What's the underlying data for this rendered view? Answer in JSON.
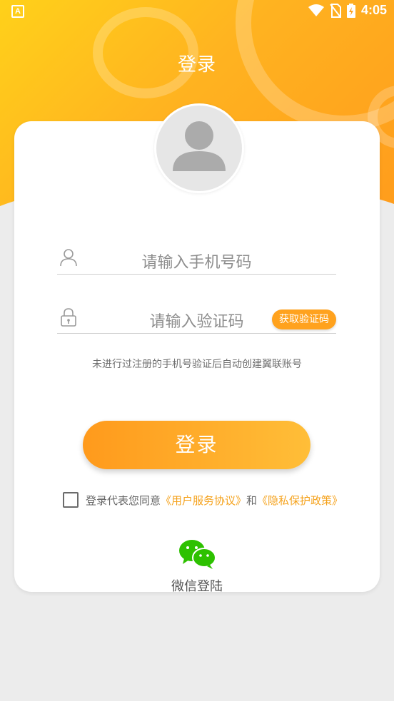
{
  "status_bar": {
    "app_badge": "A",
    "time": "4:05"
  },
  "header": {
    "title": "登录"
  },
  "form": {
    "phone_placeholder": "请输入手机号码",
    "code_placeholder": "请输入验证码",
    "get_code_label": "获取验证码",
    "hint": "未进行过注册的手机号验证后自动创建翼联账号",
    "login_label": "登录"
  },
  "agreement": {
    "prefix": "登录代表您同意",
    "user_agreement": "《用户服务协议》",
    "and": "和",
    "privacy_policy": "《隐私保护政策》",
    "checked": false
  },
  "wechat": {
    "label": "微信登陆"
  },
  "colors": {
    "accent": "#ffa21e",
    "wechat_green": "#2dc100"
  },
  "icons": [
    "app-icon",
    "wifi-icon",
    "no-sim-icon",
    "battery-icon",
    "avatar-icon",
    "user-icon",
    "lock-icon",
    "wechat-icon"
  ]
}
